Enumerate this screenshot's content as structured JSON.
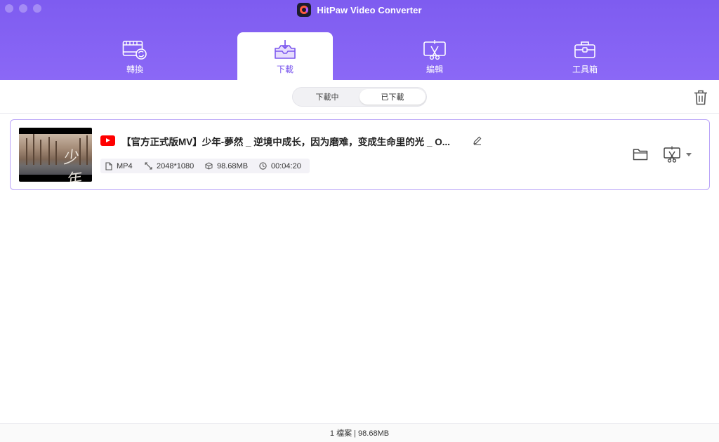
{
  "window": {
    "title": "HitPaw Video Converter"
  },
  "tabs": [
    {
      "label": "轉換",
      "icon": "film-convert-icon"
    },
    {
      "label": "下載",
      "icon": "download-tray-icon",
      "active": true
    },
    {
      "label": "編輯",
      "icon": "edit-cut-icon"
    },
    {
      "label": "工具箱",
      "icon": "toolbox-icon"
    }
  ],
  "subbar": {
    "segments": [
      "下載中",
      "已下載"
    ],
    "selected": "已下載",
    "delete_icon": "trash-icon"
  },
  "download_item": {
    "source_icon": "youtube-icon",
    "title": "【官方正式版MV】少年-夢然 _ 逆境中成长，因为磨难，变成生命里的光 _ O...",
    "thumbnail_text": "少年",
    "format": "MP4",
    "resolution": "2048*1080",
    "size": "98.68MB",
    "duration": "00:04:20"
  },
  "footer": {
    "status": "1 檔案 | 98.68MB"
  },
  "colors": {
    "accent": "#7b57ee",
    "header": "#8664f4",
    "card_border": "#b9a3f8",
    "youtube": "#ff0000"
  }
}
